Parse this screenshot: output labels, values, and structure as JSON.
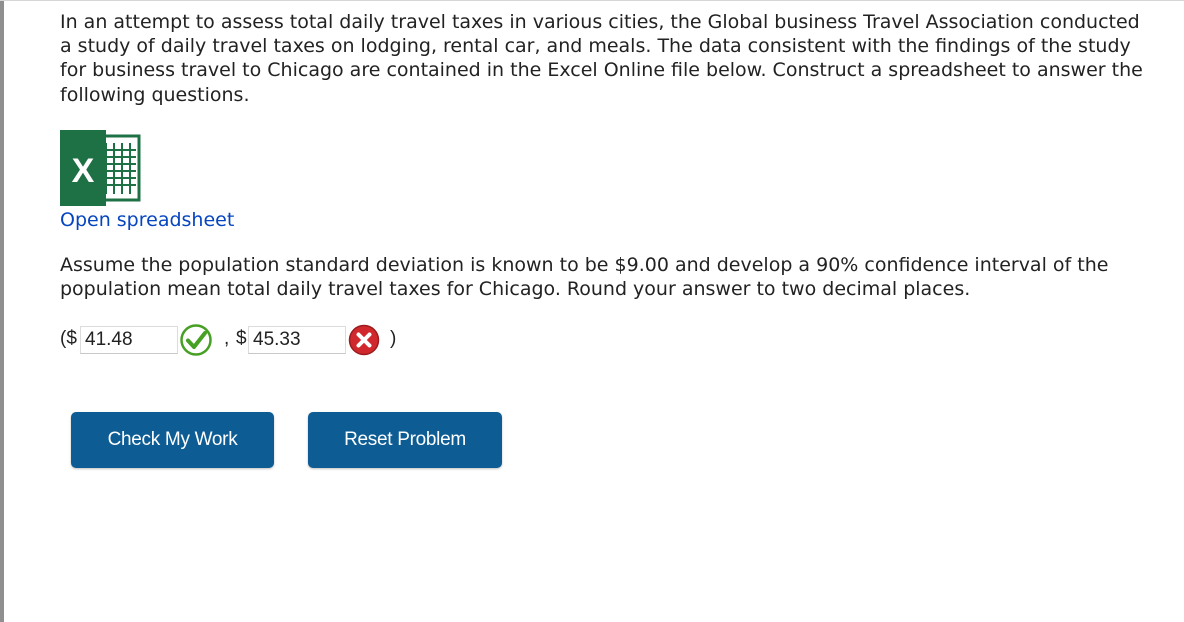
{
  "intro_text": "In an attempt to assess total daily travel taxes in various cities, the Global business Travel Association conducted a study of daily travel taxes on lodging, rental car, and meals. The data consistent with the findings of the study for business travel to Chicago are contained in the Excel Online file below. Construct a spreadsheet to answer the following questions.",
  "excel_icon": {
    "icon": "excel-icon",
    "letter": "X",
    "color": "#1e7145"
  },
  "open_link_label": "Open spreadsheet",
  "question_text": "Assume the population standard deviation is known to be $9.00 and develop a 90% confidence interval of the population mean total daily travel taxes for Chicago. Round your answer to two decimal places.",
  "answer": {
    "open_paren": "($",
    "separator": ",",
    "second_currency": "$",
    "close_paren": ")",
    "lower_value": "41.48",
    "lower_status": "correct-check-icon",
    "upper_value": "45.33",
    "upper_status": "incorrect-x-icon"
  },
  "buttons": {
    "check_label": "Check My Work",
    "reset_label": "Reset Problem"
  },
  "colors": {
    "button_bg": "#0e5c94",
    "link": "#0645c0",
    "correct": "#46a023",
    "incorrect": "#d0282c"
  }
}
